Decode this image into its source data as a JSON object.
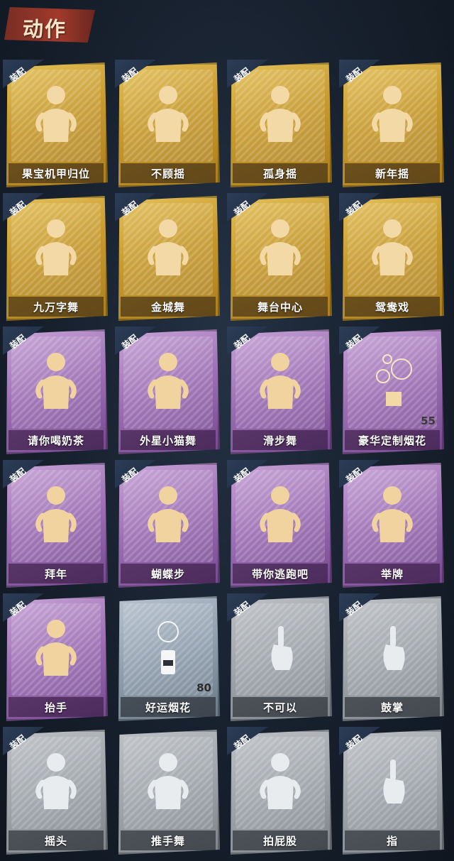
{
  "header": {
    "title": "动作"
  },
  "badge_label": "装配",
  "rows": [
    [
      {
        "label": "果宝机甲归位",
        "tier": "gold",
        "equipped": true,
        "icon": "figure-dance-icon"
      },
      {
        "label": "不顾摇",
        "tier": "gold",
        "equipped": true,
        "icon": "figure-point-icon"
      },
      {
        "label": "孤身摇",
        "tier": "gold",
        "equipped": true,
        "icon": "figure-sway-icon"
      },
      {
        "label": "新年摇",
        "tier": "gold",
        "equipped": true,
        "icon": "figure-clap-icon"
      }
    ],
    [
      {
        "label": "九万字舞",
        "tier": "gold",
        "equipped": true,
        "icon": "figure-cross-arms-icon"
      },
      {
        "label": "金城舞",
        "tier": "gold",
        "equipped": true,
        "icon": "figure-wave-icon"
      },
      {
        "label": "舞台中心",
        "tier": "gold",
        "equipped": true,
        "icon": "figure-pose-icon"
      },
      {
        "label": "鸳鸯戏",
        "tier": "gold",
        "equipped": true,
        "icon": "figure-sing-icon"
      }
    ],
    [
      {
        "label": "请你喝奶茶",
        "tier": "purple",
        "equipped": true,
        "icon": "figure-sign-icon"
      },
      {
        "label": "外星小猫舞",
        "tier": "purple",
        "equipped": true,
        "icon": "figure-arms-out-icon"
      },
      {
        "label": "滑步舞",
        "tier": "purple",
        "equipped": true,
        "icon": "figure-slide-icon"
      },
      {
        "label": "豪华定制烟花",
        "tier": "purple",
        "equipped": true,
        "icon": "fireworks-icon",
        "count": "55"
      }
    ],
    [
      {
        "label": "拜年",
        "tier": "purple",
        "equipped": true,
        "icon": "figure-bow-icon"
      },
      {
        "label": "蝴蝶步",
        "tier": "purple",
        "equipped": true,
        "icon": "figure-point-side-icon"
      },
      {
        "label": "带你逃跑吧",
        "tier": "purple",
        "equipped": true,
        "icon": "figure-run-icon"
      },
      {
        "label": "举牌",
        "tier": "purple",
        "equipped": true,
        "icon": "figure-hold-sign-icon"
      }
    ],
    [
      {
        "label": "抬手",
        "tier": "purple",
        "equipped": true,
        "icon": "figure-raise-hand-icon"
      },
      {
        "label": "好运烟花",
        "tier": "blue",
        "equipped": false,
        "icon": "firecracker-icon",
        "count": "80"
      },
      {
        "label": "不可以",
        "tier": "gray",
        "equipped": true,
        "icon": "finger-wag-icon"
      },
      {
        "label": "鼓掌",
        "tier": "gray",
        "equipped": true,
        "icon": "clapping-hands-icon"
      }
    ],
    [
      {
        "label": "摇头",
        "tier": "gray",
        "equipped": true,
        "icon": "figure-shake-head-icon"
      },
      {
        "label": "推手舞",
        "tier": "gray",
        "equipped": false,
        "icon": "figure-push-hands-icon"
      },
      {
        "label": "拍屁股",
        "tier": "gray",
        "equipped": true,
        "icon": "figure-pat-icon"
      },
      {
        "label": "指",
        "tier": "gray",
        "equipped": true,
        "icon": "pointing-hand-icon"
      }
    ]
  ]
}
